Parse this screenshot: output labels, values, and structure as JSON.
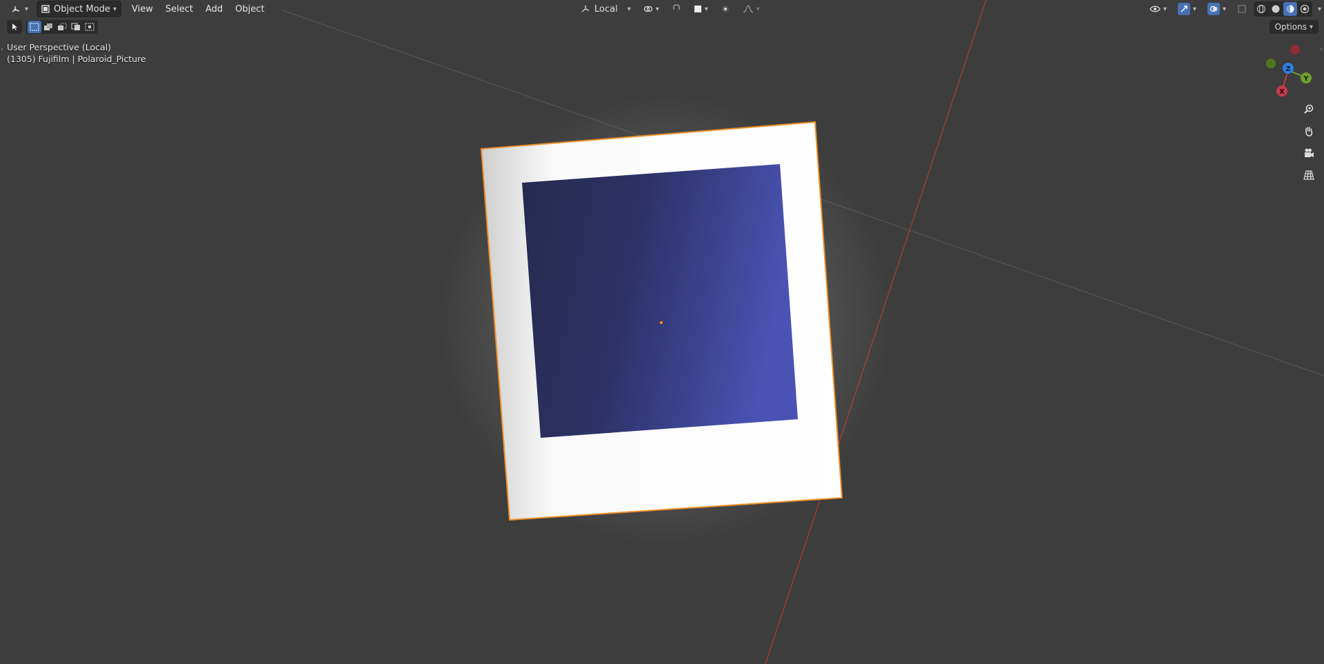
{
  "header": {
    "mode_label": "Object Mode",
    "menus": [
      "View",
      "Select",
      "Add",
      "Object"
    ],
    "orientation_label": "Local"
  },
  "viewport": {
    "perspective_label": "User Perspective (Local)",
    "object_label": "(1305) Fujifilm | Polaroid_Picture",
    "options_label": "Options"
  },
  "gizmo": {
    "x_label": "X",
    "y_label": "Y",
    "z_label": "Z"
  },
  "icons": {
    "editor_type": "view3d-icon",
    "mode": "object-mode-icon",
    "select_tool": "cursor-select-icon",
    "zoom": "zoom-icon",
    "pan": "hand-icon",
    "camera": "camera-icon",
    "grid": "ortho-grid-icon"
  },
  "colors": {
    "background": "#3d3d3d",
    "selection_outline": "#f0902a",
    "photo_frame": "#f7f7f7",
    "photo_dark": "#2a2f5a",
    "photo_light": "#4a55b8",
    "axis_red": "#b83a3a",
    "axis_green": "#70a030",
    "axis_blue": "#2f7fe0",
    "accent": "#4772b3"
  }
}
